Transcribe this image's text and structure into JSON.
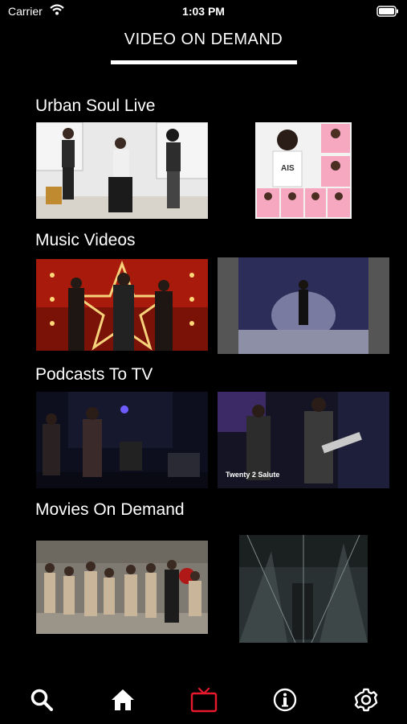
{
  "status_bar": {
    "carrier": "Carrier",
    "time": "1:03 PM"
  },
  "header": {
    "title": "VIDEO ON DEMAND"
  },
  "sections": [
    {
      "title": "Urban Soul Live"
    },
    {
      "title": "Music Videos"
    },
    {
      "title": "Podcasts To TV",
      "caption": "Twenty 2 Salute"
    },
    {
      "title": "Movies On Demand"
    }
  ],
  "tab_bar": {
    "active_color": "#e8192c",
    "icons": [
      "search-icon",
      "home-icon",
      "tv-icon",
      "info-icon",
      "settings-icon"
    ]
  }
}
